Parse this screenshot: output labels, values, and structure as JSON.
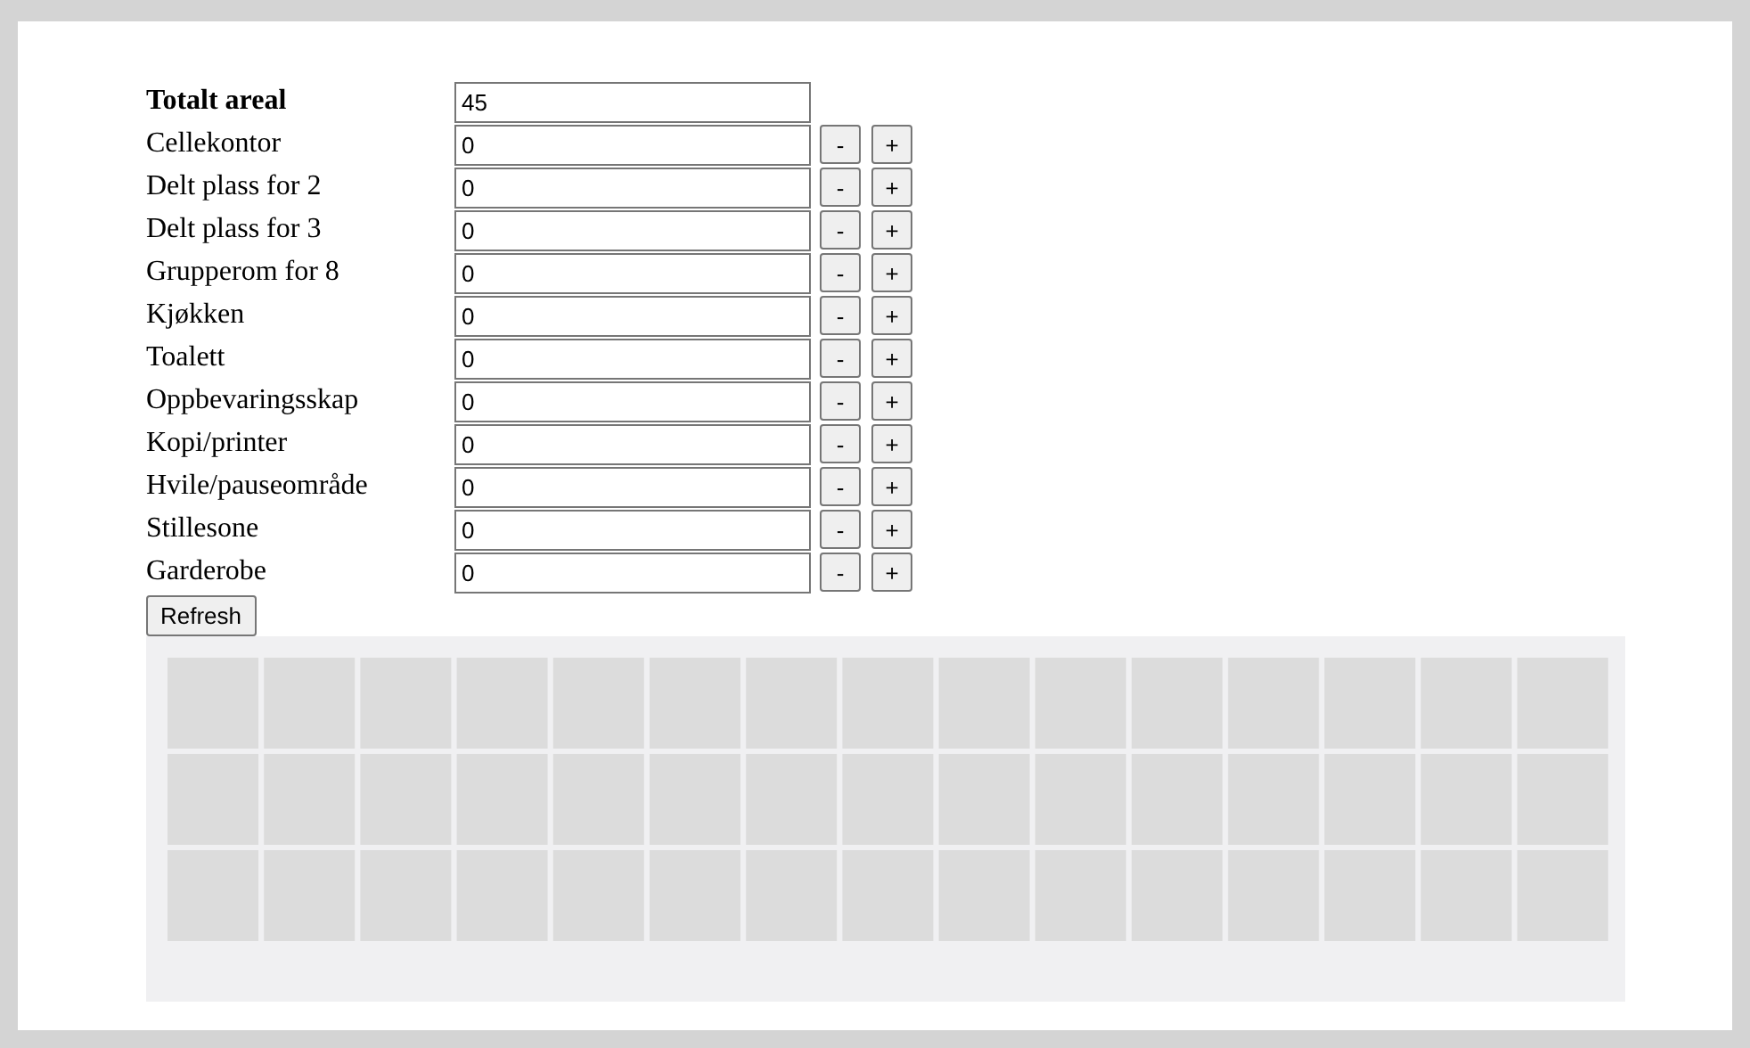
{
  "total": {
    "label": "Totalt areal",
    "value": "45"
  },
  "rooms": [
    {
      "label": "Cellekontor",
      "value": "0",
      "minus": "-",
      "plus": "+"
    },
    {
      "label": "Delt plass for 2",
      "value": "0",
      "minus": "-",
      "plus": "+"
    },
    {
      "label": "Delt plass for 3",
      "value": "0",
      "minus": "-",
      "plus": "+"
    },
    {
      "label": "Grupperom for 8",
      "value": "0",
      "minus": "-",
      "plus": "+"
    },
    {
      "label": "Kjøkken",
      "value": "0",
      "minus": "-",
      "plus": "+"
    },
    {
      "label": "Toalett",
      "value": "0",
      "minus": "-",
      "plus": "+"
    },
    {
      "label": "Oppbevaringsskap",
      "value": "0",
      "minus": "-",
      "plus": "+"
    },
    {
      "label": "Kopi/printer",
      "value": "0",
      "minus": "-",
      "plus": "+"
    },
    {
      "label": "Hvile/pauseområde",
      "value": "0",
      "minus": "-",
      "plus": "+"
    },
    {
      "label": "Stillesone",
      "value": "0",
      "minus": "-",
      "plus": "+"
    },
    {
      "label": "Garderobe",
      "value": "0",
      "minus": "-",
      "plus": "+"
    }
  ],
  "refresh_button": "Refresh"
}
